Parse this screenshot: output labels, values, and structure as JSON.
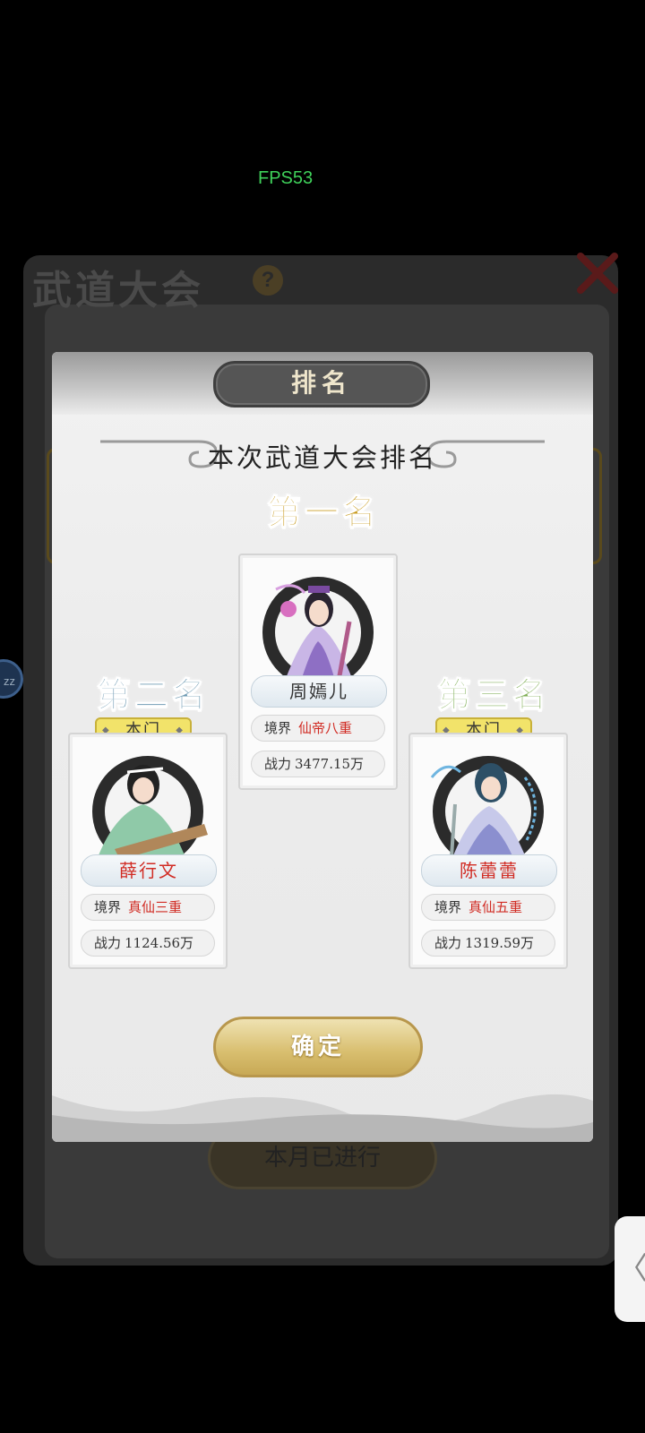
{
  "debug": {
    "fps_text": "FPS53"
  },
  "background": {
    "title": "武道大会",
    "help_icon": "?",
    "month_button_label": "本月已进行",
    "side_bubble_text": "zz",
    "edge_tab_glyph": "〈"
  },
  "dialog": {
    "title": "排名",
    "banner": "本次武道大会排名",
    "confirm_label": "确定",
    "ranks": {
      "first": {
        "rank_label": "第一名",
        "name": "周嫣儿",
        "realm_label": "境界",
        "realm_value": "仙帝八重",
        "power_label": "战力",
        "power_value": "3477.15万"
      },
      "second": {
        "rank_label": "第二名",
        "sect_tag": "本门",
        "name": "薛行文",
        "realm_label": "境界",
        "realm_value": "真仙三重",
        "power_label": "战力",
        "power_value": "1124.56万"
      },
      "third": {
        "rank_label": "第三名",
        "sect_tag": "本门",
        "name": "陈蕾蕾",
        "realm_label": "境界",
        "realm_value": "真仙五重",
        "power_label": "战力",
        "power_value": "1319.59万"
      }
    }
  },
  "colors": {
    "rank_first": "#c89b20",
    "rank_second": "#6d99b2",
    "rank_third": "#7fae55",
    "highlight_red": "#d12c24",
    "fps_green": "#3fd15a"
  },
  "icons": {
    "help": "question-icon",
    "close": "close-x-icon",
    "edge": "chevron-left-icon"
  }
}
